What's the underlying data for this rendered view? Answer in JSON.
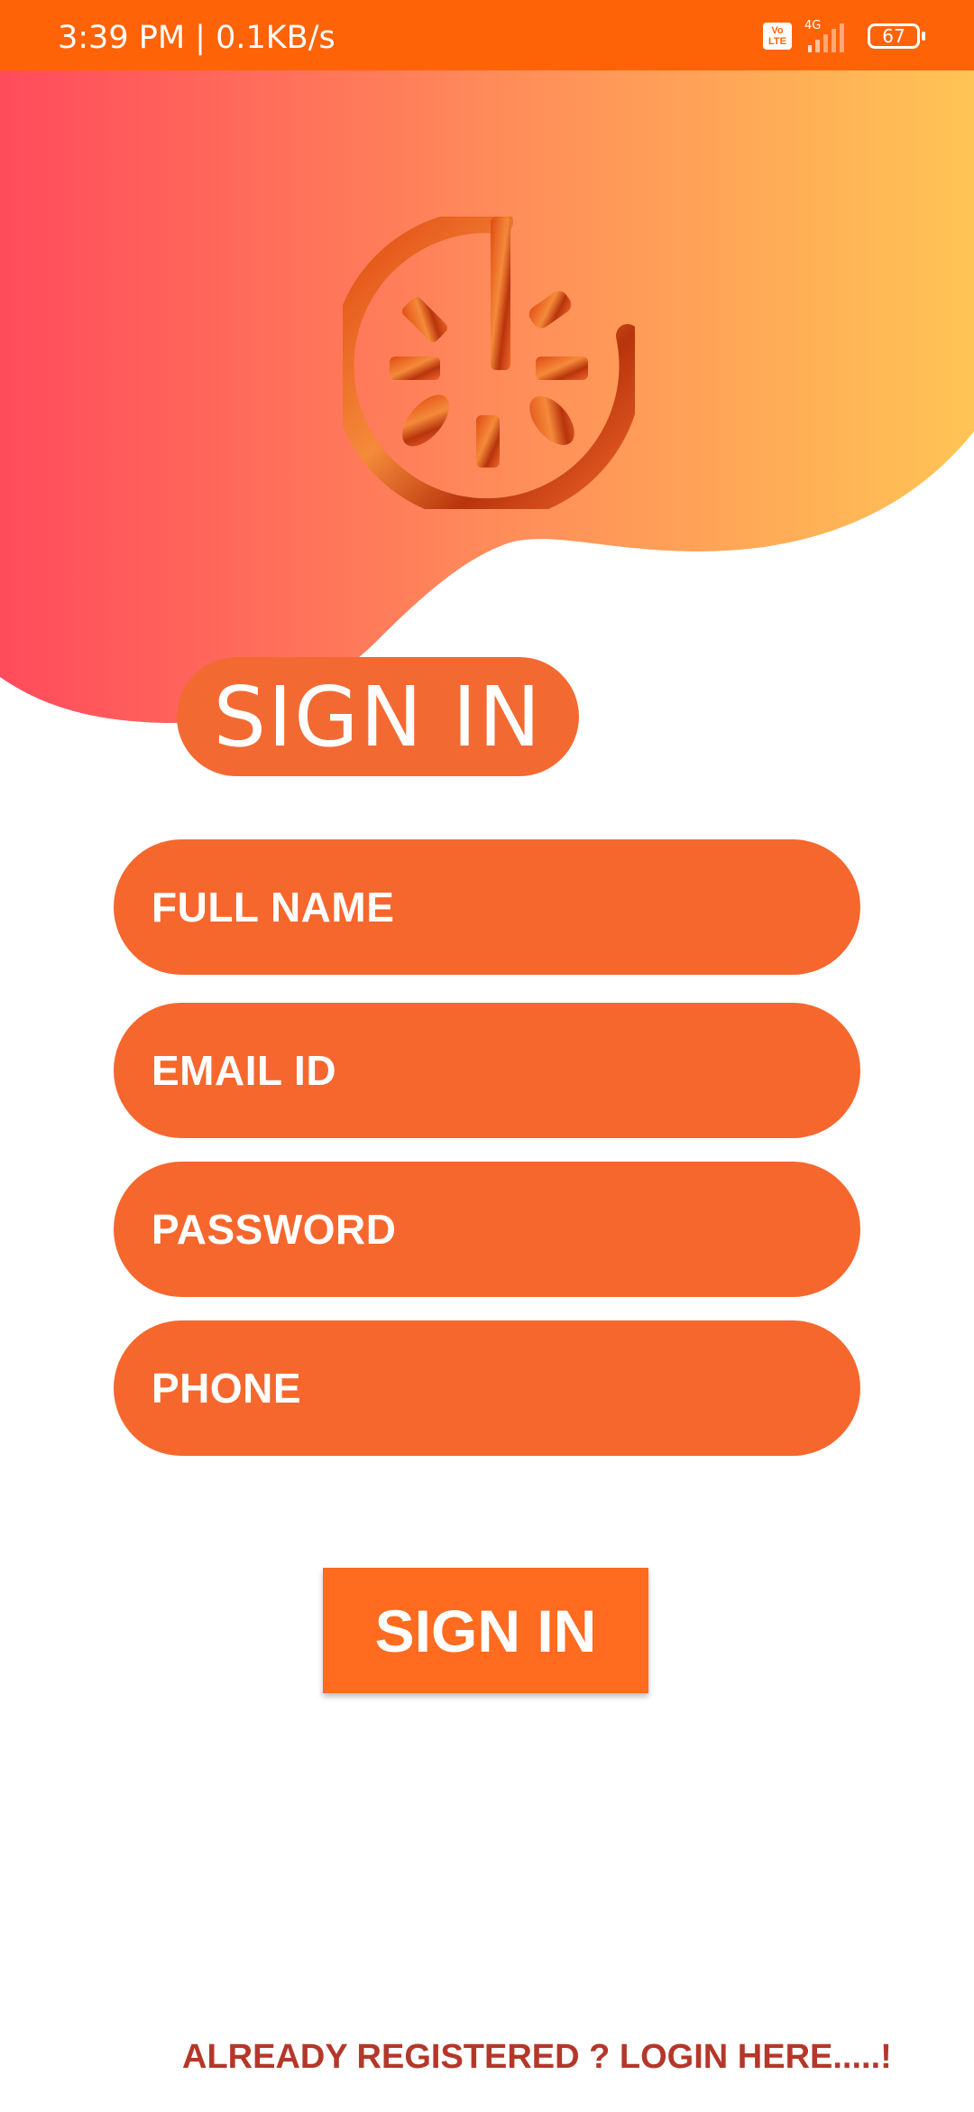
{
  "status_bar": {
    "time_speed": "3:39 PM | 0.1KB/s",
    "volte_label": "Vo LTE",
    "network_label": "4G",
    "battery_level": "67"
  },
  "header": {
    "logo_icon": "pizza-logo-icon",
    "colors": {
      "gradient_start": "#ff4b5c",
      "gradient_mid": "#ff8a5a",
      "gradient_end": "#ffc455"
    }
  },
  "title": "SIGN IN",
  "form": {
    "full_name_placeholder": "FULL NAME",
    "email_placeholder": "EMAIL ID",
    "password_placeholder": "PASSWORD",
    "phone_placeholder": "PHONE",
    "submit_label": "SIGN IN"
  },
  "footer": {
    "login_link": "ALREADY REGISTERED ? LOGIN HERE.....!"
  },
  "colors": {
    "accent": "#f6672e",
    "status_bar": "#ff6308",
    "link": "#b5372a"
  }
}
